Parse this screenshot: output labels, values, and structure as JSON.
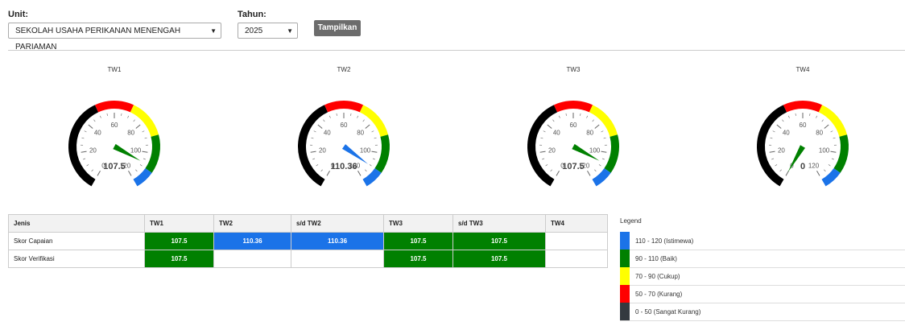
{
  "filters": {
    "unit_label": "Unit:",
    "unit_value": "SEKOLAH USAHA PERIKANAN MENENGAH PARIAMAN",
    "year_label": "Tahun:",
    "year_value": "2025",
    "show_button": "Tampilkan"
  },
  "gauges": [
    {
      "title": "TW1",
      "value": 107.5,
      "display": "107.5",
      "needle_color": "#008000"
    },
    {
      "title": "TW2",
      "value": 110.36,
      "display": "110.36",
      "needle_color": "#1b73e8"
    },
    {
      "title": "TW3",
      "value": 107.5,
      "display": "107.5",
      "needle_color": "#008000"
    },
    {
      "title": "TW4",
      "value": 0,
      "display": "0",
      "needle_color": "#008000"
    }
  ],
  "gauge_ticks": [
    "0",
    "20",
    "40",
    "60",
    "80",
    "100",
    "120"
  ],
  "gauge_bands": [
    {
      "from": 0,
      "to": 50,
      "color": "#000000"
    },
    {
      "from": 50,
      "to": 70,
      "color": "#ff0000"
    },
    {
      "from": 70,
      "to": 90,
      "color": "#ffff00"
    },
    {
      "from": 90,
      "to": 110,
      "color": "#008000"
    },
    {
      "from": 110,
      "to": 120,
      "color": "#1b73e8"
    }
  ],
  "table": {
    "headers": [
      "Jenis",
      "TW1",
      "TW2",
      "s/d TW2",
      "TW3",
      "s/d TW3",
      "TW4"
    ],
    "rows": [
      {
        "label": "Skor Capaian",
        "cells": [
          "107.5",
          "110.36",
          "110.36",
          "107.5",
          "107.5",
          ""
        ]
      },
      {
        "label": "Skor Verifikasi",
        "cells": [
          "107.5",
          "",
          "",
          "107.5",
          "107.5",
          ""
        ]
      }
    ]
  },
  "legend": {
    "title": "Legend",
    "items": [
      {
        "label": "110 - 120 (Istimewa)",
        "color": "#1b73e8"
      },
      {
        "label": "90 - 110 (Baik)",
        "color": "#008000"
      },
      {
        "label": "70 - 90 (Cukup)",
        "color": "#ffff00"
      },
      {
        "label": "50 - 70 (Kurang)",
        "color": "#ff0000"
      },
      {
        "label": "0 - 50 (Sangat Kurang)",
        "color": "#343a40"
      }
    ]
  }
}
